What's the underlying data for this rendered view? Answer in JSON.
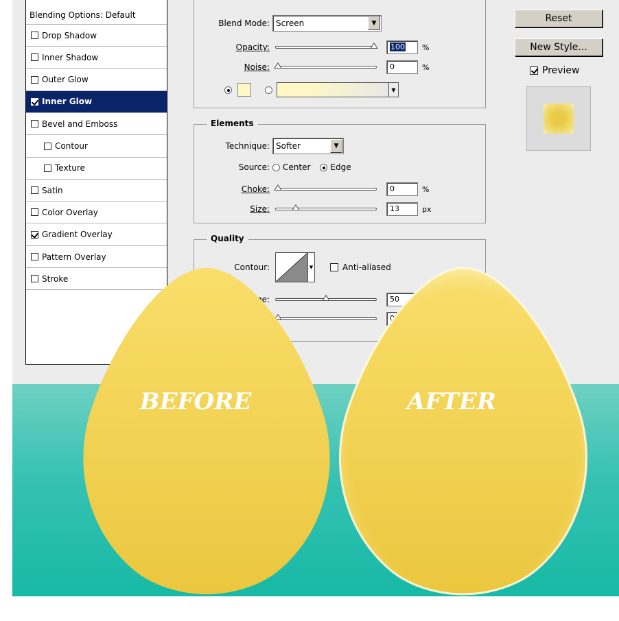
{
  "styles_list": {
    "header": "Blending Options: Default",
    "items": [
      {
        "label": "Drop Shadow",
        "checked": false,
        "indent": false,
        "selected": false
      },
      {
        "label": "Inner Shadow",
        "checked": false,
        "indent": false,
        "selected": false
      },
      {
        "label": "Outer Glow",
        "checked": false,
        "indent": false,
        "selected": false
      },
      {
        "label": "Inner Glow",
        "checked": true,
        "indent": false,
        "selected": true
      },
      {
        "label": "Bevel and Emboss",
        "checked": false,
        "indent": false,
        "selected": false
      },
      {
        "label": "Contour",
        "checked": false,
        "indent": true,
        "selected": false
      },
      {
        "label": "Texture",
        "checked": false,
        "indent": true,
        "selected": false
      },
      {
        "label": "Satin",
        "checked": false,
        "indent": false,
        "selected": false
      },
      {
        "label": "Color Overlay",
        "checked": false,
        "indent": false,
        "selected": false
      },
      {
        "label": "Gradient Overlay",
        "checked": true,
        "indent": false,
        "selected": false
      },
      {
        "label": "Pattern Overlay",
        "checked": false,
        "indent": false,
        "selected": false
      },
      {
        "label": "Stroke",
        "checked": false,
        "indent": false,
        "selected": false
      }
    ]
  },
  "structure": {
    "blend_mode_label": "Blend Mode:",
    "blend_mode_value": "Screen",
    "opacity_label": "Opacity:",
    "opacity_value": "100",
    "opacity_unit": "%",
    "noise_label": "Noise:",
    "noise_value": "0",
    "noise_unit": "%",
    "glow_color": "#fdf7c6"
  },
  "elements": {
    "legend": "Elements",
    "technique_label": "Technique:",
    "technique_value": "Softer",
    "source_label": "Source:",
    "source_center": "Center",
    "source_edge": "Edge",
    "choke_label": "Choke:",
    "choke_value": "0",
    "choke_unit": "%",
    "size_label": "Size:",
    "size_value": "13",
    "size_unit": "px"
  },
  "quality": {
    "legend": "Quality",
    "contour_label": "Contour:",
    "anti_aliased_label": "Anti-aliased",
    "range_label_partial": "ge:",
    "range_value": "50",
    "jitter_value": "0"
  },
  "buttons": {
    "reset": "Reset",
    "new_style": "New Style...",
    "preview_label": "Preview"
  },
  "canvas": {
    "before_label": "BEFORE",
    "after_label": "AFTER",
    "egg_color": "#f2d25a",
    "teal_color": "#1fbaa8"
  }
}
